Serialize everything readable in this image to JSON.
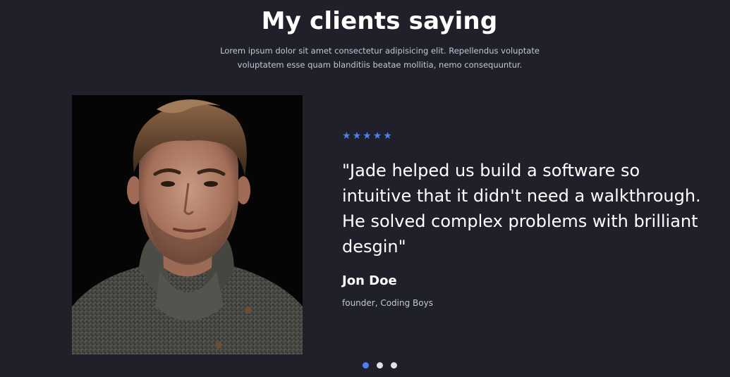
{
  "section": {
    "title": "My clients saying",
    "subtitle": "Lorem ipsum dolor sit amet consectetur adipisicing elit. Repellendus voluptate voluptatem esse quam blanditiis beatae mollitia, nemo consequuntur."
  },
  "testimonial": {
    "rating": 5,
    "rating_max": 5,
    "star_glyph": "★",
    "quote": "\"Jade helped us build a software so intuitive that it didn't need a walkthrough. He solved complex problems with brilliant desgin\"",
    "name": "Jon Doe",
    "role": "founder, Coding Boys",
    "photo_icon": "client-portrait"
  },
  "carousel": {
    "count": 3,
    "active_index": 0
  },
  "colors": {
    "background": "#1f2029",
    "accent": "#4f7df3",
    "text": "#ffffff",
    "muted": "#c4c7d4",
    "inactive_dot": "#e1e2e6"
  }
}
